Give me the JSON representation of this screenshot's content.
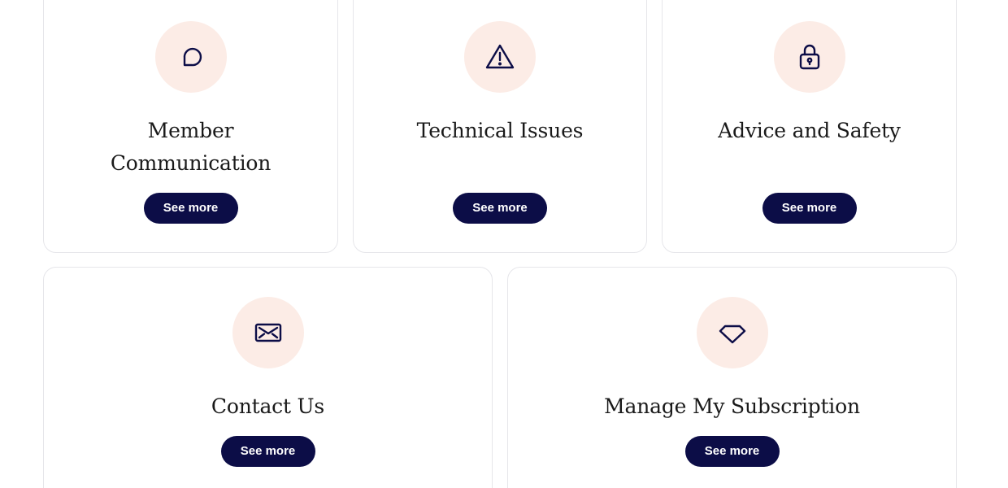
{
  "cards": [
    {
      "title": "Member Communication",
      "icon": "chat-bubble-icon",
      "button_label": "See more"
    },
    {
      "title": "Technical Issues",
      "icon": "warning-triangle-icon",
      "button_label": "See more"
    },
    {
      "title": "Advice and Safety",
      "icon": "padlock-icon",
      "button_label": "See more"
    },
    {
      "title": "Contact Us",
      "icon": "envelope-icon",
      "button_label": "See more"
    },
    {
      "title": "Manage My Subscription",
      "icon": "diamond-icon",
      "button_label": "See more"
    }
  ],
  "colors": {
    "icon_background": "#fcece6",
    "icon_stroke": "#0c0d47",
    "button_background": "#0c0d47",
    "button_text": "#ffffff",
    "card_border": "#e6e6ea",
    "title_text": "#1a1a1a"
  }
}
